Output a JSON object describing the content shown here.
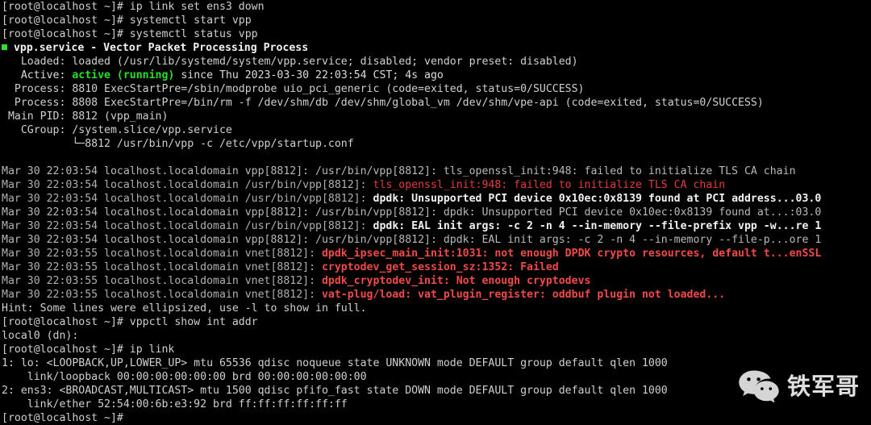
{
  "terminal": {
    "prompt": "[root@localhost ~]#",
    "colors": {
      "background": "#000000",
      "foreground": "#d0d0d0",
      "green": "#26e026",
      "red": "#e33c3c",
      "bright_white": "#f2f2f2"
    },
    "lines": [
      {
        "id": "cmd-ip-link-set",
        "type": "command",
        "text": "[root@localhost ~]# ip link set ens3 down"
      },
      {
        "id": "cmd-systemctl-start",
        "type": "command",
        "text": "[root@localhost ~]# systemctl start vpp"
      },
      {
        "id": "cmd-systemctl-status",
        "type": "command",
        "text": "[root@localhost ~]# systemctl status vpp"
      },
      {
        "id": "svc-title",
        "type": "service-title",
        "bullet": true,
        "text": " vpp.service - Vector Packet Processing Process"
      },
      {
        "id": "svc-loaded",
        "type": "output",
        "text": "   Loaded: loaded (/usr/lib/systemd/system/vpp.service; disabled; vendor preset: disabled)"
      },
      {
        "id": "svc-active-pre",
        "type": "output",
        "text": "   Active: "
      },
      {
        "id": "svc-active-state",
        "type": "output-green",
        "text": "active (running)"
      },
      {
        "id": "svc-active-post",
        "type": "output",
        "text": " since Thu 2023-03-30 22:03:54 CST; 4s ago"
      },
      {
        "id": "svc-process-1",
        "type": "output",
        "text": "  Process: 8810 ExecStartPre=/sbin/modprobe uio_pci_generic (code=exited, status=0/SUCCESS)"
      },
      {
        "id": "svc-process-2",
        "type": "output",
        "text": "  Process: 8808 ExecStartPre=/bin/rm -f /dev/shm/db /dev/shm/global_vm /dev/shm/vpe-api (code=exited, status=0/SUCCESS)"
      },
      {
        "id": "svc-mainpid",
        "type": "output",
        "text": " Main PID: 8812 (vpp_main)"
      },
      {
        "id": "svc-cgroup",
        "type": "output",
        "text": "   CGroup: /system.slice/vpp.service"
      },
      {
        "id": "svc-cgroup-child",
        "type": "output",
        "text": "           └─8812 /usr/bin/vpp -c /etc/vpp/startup.conf"
      },
      {
        "id": "blank-1",
        "type": "blank",
        "text": ""
      },
      {
        "id": "log-1-prefix",
        "type": "log",
        "text": "Mar 30 22:03:54 localhost.localdomain vpp[8812]: /usr/bin/vpp[8812]: tls_openssl_init:948: failed to initialize TLS CA chain"
      },
      {
        "id": "log-2-prefix",
        "type": "log",
        "text": "Mar 30 22:03:54 localhost.localdomain /usr/bin/vpp[8812]: "
      },
      {
        "id": "log-2-red",
        "type": "log-red",
        "text": "tls_openssl_init:948: failed to initialize TLS CA chain"
      },
      {
        "id": "log-3-prefix",
        "type": "log",
        "text": "Mar 30 22:03:54 localhost.localdomain /usr/bin/vpp[8812]: "
      },
      {
        "id": "log-3-bold",
        "type": "log-bright",
        "text": "dpdk: Unsupported PCI device 0x10ec:0x8139 found at PCI address...03.0"
      },
      {
        "id": "log-4",
        "type": "log",
        "text": "Mar 30 22:03:54 localhost.localdomain vpp[8812]: /usr/bin/vpp[8812]: dpdk: Unsupported PCI device 0x10ec:0x8139 found at...:03.0"
      },
      {
        "id": "log-5-prefix",
        "type": "log",
        "text": "Mar 30 22:03:54 localhost.localdomain /usr/bin/vpp[8812]: "
      },
      {
        "id": "log-5-bold",
        "type": "log-bright",
        "text": "dpdk: EAL init args: -c 2 -n 4 --in-memory --file-prefix vpp -w...re 1"
      },
      {
        "id": "log-6",
        "type": "log",
        "text": "Mar 30 22:03:54 localhost.localdomain vpp[8812]: /usr/bin/vpp[8812]: dpdk: EAL init args: -c 2 -n 4 --in-memory --file-p...ore 1"
      },
      {
        "id": "log-7-prefix",
        "type": "log",
        "text": "Mar 30 22:03:55 localhost.localdomain vnet[8812]: "
      },
      {
        "id": "log-7-red",
        "type": "log-red-bold",
        "text": "dpdk_ipsec_main_init:1031: not enough DPDK crypto resources, default t...enSSL"
      },
      {
        "id": "log-8-prefix",
        "type": "log",
        "text": "Mar 30 22:03:55 localhost.localdomain vnet[8812]: "
      },
      {
        "id": "log-8-red",
        "type": "log-red-bold",
        "text": "cryptodev_get_session_sz:1352: Failed"
      },
      {
        "id": "log-9-prefix",
        "type": "log",
        "text": "Mar 30 22:03:55 localhost.localdomain vnet[8812]: "
      },
      {
        "id": "log-9-red",
        "type": "log-red-bold",
        "text": "dpdk_cryptodev_init: Not enough cryptodevs"
      },
      {
        "id": "log-10-prefix",
        "type": "log",
        "text": "Mar 30 22:03:55 localhost.localdomain vnet[8812]: "
      },
      {
        "id": "log-10-red",
        "type": "log-red-bold",
        "text": "vat-plug/load: vat_plugin_register: oddbuf plugin not loaded..."
      },
      {
        "id": "hint",
        "type": "output",
        "text": "Hint: Some lines were ellipsized, use -l to show in full."
      },
      {
        "id": "cmd-vppctl",
        "type": "command",
        "text": "[root@localhost ~]# vppctl show int addr"
      },
      {
        "id": "out-local0",
        "type": "output",
        "text": "local0 (dn):"
      },
      {
        "id": "cmd-ip-link",
        "type": "command",
        "text": "[root@localhost ~]# ip link"
      },
      {
        "id": "iplink-lo",
        "type": "output",
        "text": "1: lo: <LOOPBACK,UP,LOWER_UP> mtu 65536 qdisc noqueue state UNKNOWN mode DEFAULT group default qlen 1000"
      },
      {
        "id": "iplink-lo-addr",
        "type": "output",
        "text": "    link/loopback 00:00:00:00:00:00 brd 00:00:00:00:00:00"
      },
      {
        "id": "iplink-ens3",
        "type": "output",
        "text": "2: ens3: <BROADCAST,MULTICAST> mtu 1500 qdisc pfifo_fast state DOWN mode DEFAULT group default qlen 1000"
      },
      {
        "id": "iplink-ens3-addr",
        "type": "output",
        "text": "    link/ether 52:54:00:6b:e3:92 brd ff:ff:ff:ff:ff:ff"
      },
      {
        "id": "cmd-final",
        "type": "command",
        "text": "[root@localhost ~]#"
      }
    ]
  },
  "watermark": {
    "icon": "wechat-logo-icon",
    "label": "铁军哥"
  }
}
